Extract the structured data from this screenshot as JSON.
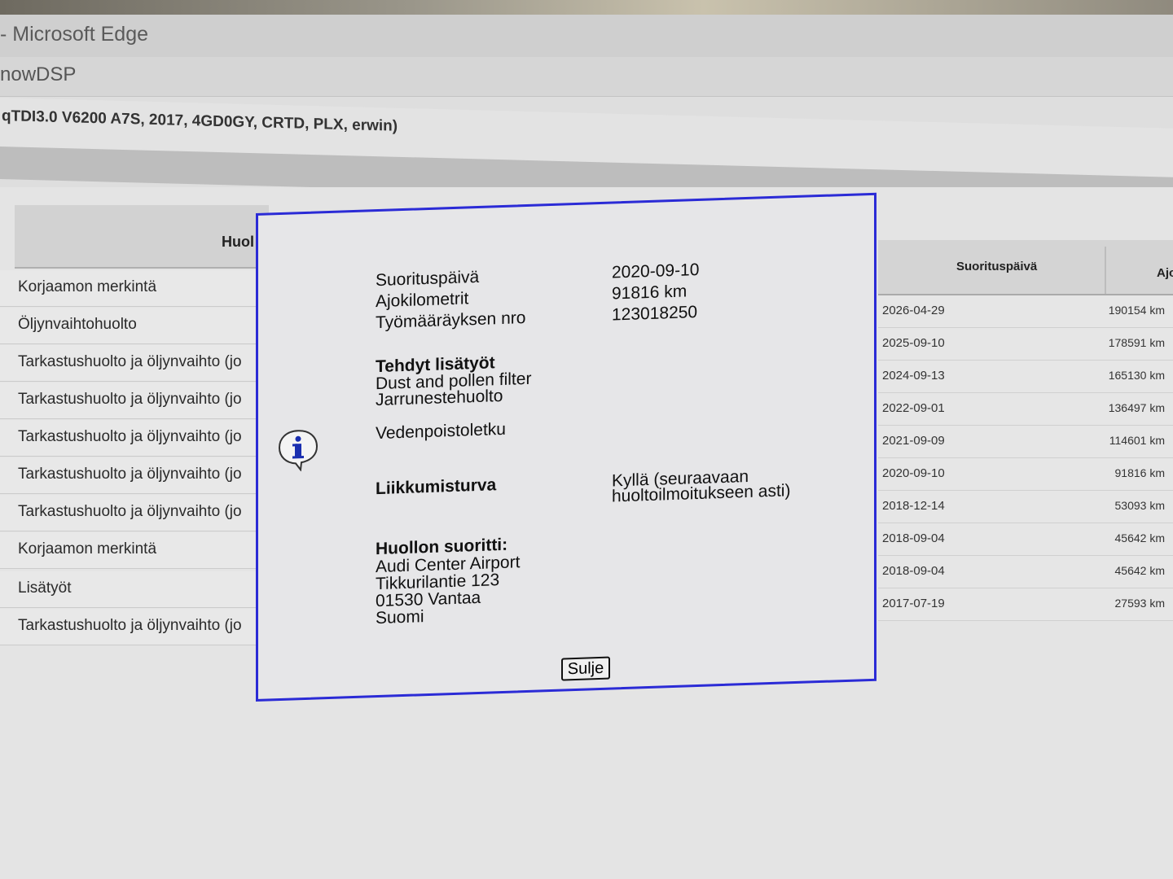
{
  "window": {
    "title": "- Microsoft Edge",
    "app": "nowDSP",
    "vehicle": "qTDI3.0 V6200 A7S, 2017, 4GD0GY, CRTD, PLX, erwin)"
  },
  "left_table": {
    "header": "Huol",
    "rows": [
      "Korjaamon merkintä",
      "Öljynvaihtohuolto",
      "Tarkastushuolto ja öljynvaihto (jo",
      "Tarkastushuolto ja öljynvaihto (jo",
      "Tarkastushuolto ja öljynvaihto (jo",
      "Tarkastushuolto ja öljynvaihto (jo",
      "Tarkastushuolto ja öljynvaihto (jo",
      "Korjaamon merkintä",
      "Lisätyöt",
      "Tarkastushuolto ja öljynvaihto (jo"
    ]
  },
  "right_table": {
    "col_date": "Suorituspäivä",
    "col_km": "Ajo",
    "rows": [
      {
        "date": "2026-04-29",
        "km": "190154 km"
      },
      {
        "date": "2025-09-10",
        "km": "178591 km"
      },
      {
        "date": "2024-09-13",
        "km": "165130 km"
      },
      {
        "date": "2022-09-01",
        "km": "136497 km"
      },
      {
        "date": "2021-09-09",
        "km": "114601 km"
      },
      {
        "date": "2020-09-10",
        "km": "91816 km"
      },
      {
        "date": "2018-12-14",
        "km": "53093 km"
      },
      {
        "date": "2018-09-04",
        "km": "45642 km"
      },
      {
        "date": "2018-09-04",
        "km": "45642 km"
      },
      {
        "date": "2017-07-19",
        "km": "27593 km"
      }
    ]
  },
  "dialog": {
    "date_label": "Suorituspäivä",
    "date_value": "2020-09-10",
    "km_label": "Ajokilometrit",
    "km_value": "91816 km",
    "order_label": "Työmääräyksen nro",
    "order_value": "123018250",
    "extra_title": "Tehdyt lisätyöt",
    "extra_items": [
      "Dust and pollen filter",
      "Jarrunestehuolto",
      "Vedenpoistoletku"
    ],
    "mobility_label": "Liikkumisturva",
    "mobility_value_1": "Kyllä (seuraavaan",
    "mobility_value_2": "huoltoilmoitukseen asti)",
    "performer_title": "Huollon suoritti:",
    "performer_lines": [
      "Audi Center Airport",
      "Tikkurilantie 123",
      "01530 Vantaa",
      "Suomi"
    ],
    "close_label": "Sulje",
    "icon": "info-icon"
  },
  "colors": {
    "dialog_border": "#2b2bd6",
    "dialog_bg": "#e6e6e8",
    "page_bg": "#e4e4e4"
  }
}
